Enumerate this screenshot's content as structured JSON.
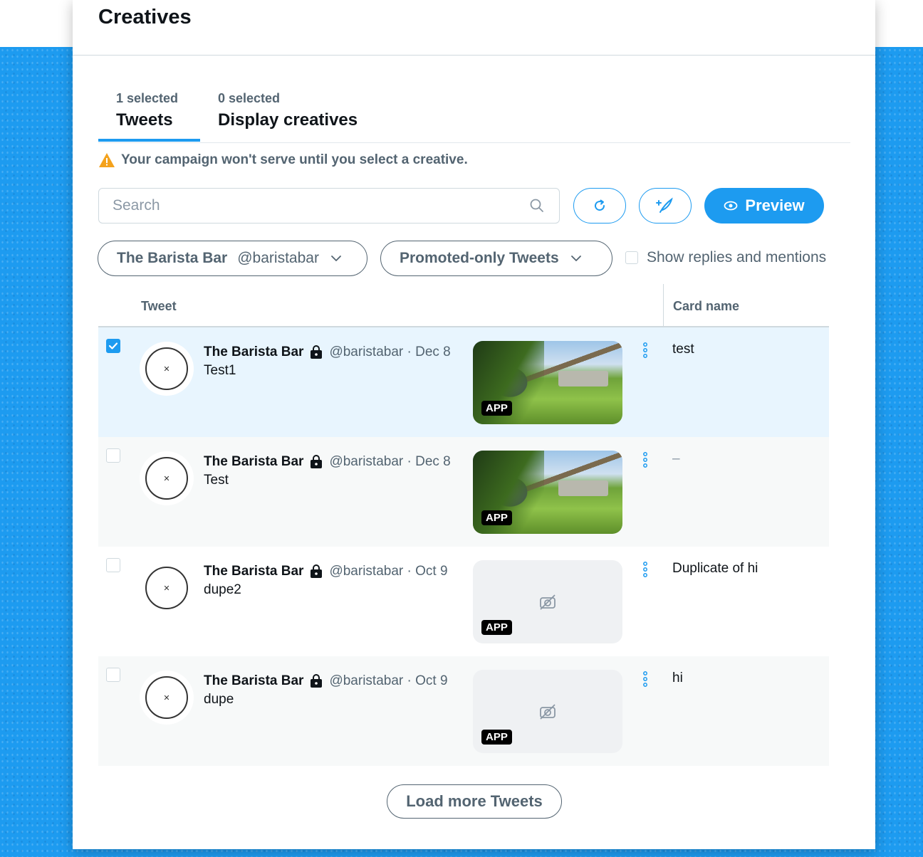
{
  "page": {
    "title": "Creatives"
  },
  "tabs": [
    {
      "count": "1 selected",
      "label": "Tweets"
    },
    {
      "count": "0 selected",
      "label": "Display creatives"
    }
  ],
  "warning": {
    "text": "Your campaign won't serve until you select a creative."
  },
  "toolbar": {
    "search_placeholder": "Search",
    "search_value": "",
    "preview_label": "Preview"
  },
  "filters": {
    "account_name": "The Barista Bar",
    "account_handle": "@baristabar",
    "tweet_type": "Promoted-only Tweets",
    "show_replies_label": "Show replies and mentions",
    "show_replies_checked": false
  },
  "table": {
    "headers": {
      "tweet": "Tweet",
      "card_name": "Card name"
    },
    "rows": [
      {
        "checked": true,
        "account": "The Barista Bar",
        "meta": "@baristabar · Dec 8",
        "text": "Test1",
        "media": "image",
        "badge": "APP",
        "card_name": "test"
      },
      {
        "checked": false,
        "account": "The Barista Bar",
        "meta": "@baristabar · Dec 8",
        "text": "Test",
        "media": "image",
        "badge": "APP",
        "card_name": "–"
      },
      {
        "checked": false,
        "account": "The Barista Bar",
        "meta": "@baristabar · Oct 9",
        "text": "dupe2",
        "media": "no-image",
        "badge": "APP",
        "card_name": "Duplicate of hi"
      },
      {
        "checked": false,
        "account": "The Barista Bar",
        "meta": "@baristabar · Oct 9",
        "text": "dupe",
        "media": "no-image",
        "badge": "APP",
        "card_name": "hi"
      }
    ]
  },
  "load_more_label": "Load more Tweets",
  "colors": {
    "accent": "#1d9bf0",
    "text_primary": "#0f1419",
    "text_secondary": "#536471",
    "warning": "#f4a21c"
  }
}
